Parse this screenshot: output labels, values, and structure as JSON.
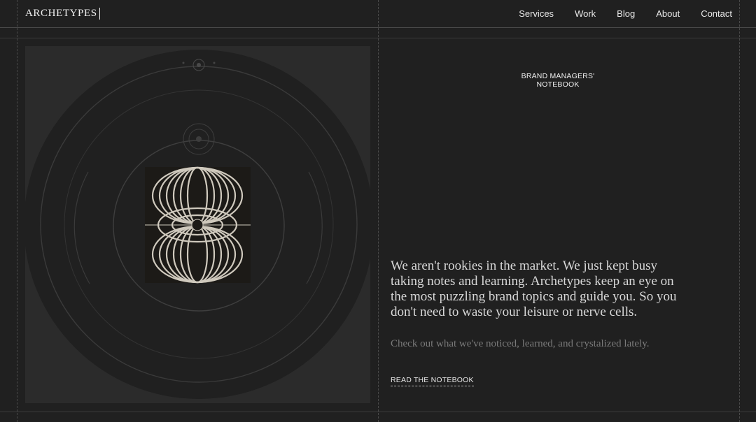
{
  "brand": {
    "logo_text": "ARCHETYPES"
  },
  "nav": {
    "items": [
      {
        "label": "Services"
      },
      {
        "label": "Work"
      },
      {
        "label": "Blog"
      },
      {
        "label": "About"
      },
      {
        "label": "Contact"
      }
    ]
  },
  "section": {
    "kicker_line1": "BRAND MANAGERS'",
    "kicker_line2": "NOTEBOOK",
    "lead": "We aren't rookies in the market. We just kept busy taking notes and learning. Archetypes keep an eye on the most puzzling brand topics and guide you. So you don't need to waste your leisure or nerve cells.",
    "sub": "Check out what we've noticed, learned, and crystalized lately.",
    "cta_label": "READ THE NOTEBOOK"
  },
  "colors": {
    "background": "#202020",
    "panel": "#2b2b2b",
    "text": "#e6e6e6",
    "muted": "#7a7a7a"
  }
}
